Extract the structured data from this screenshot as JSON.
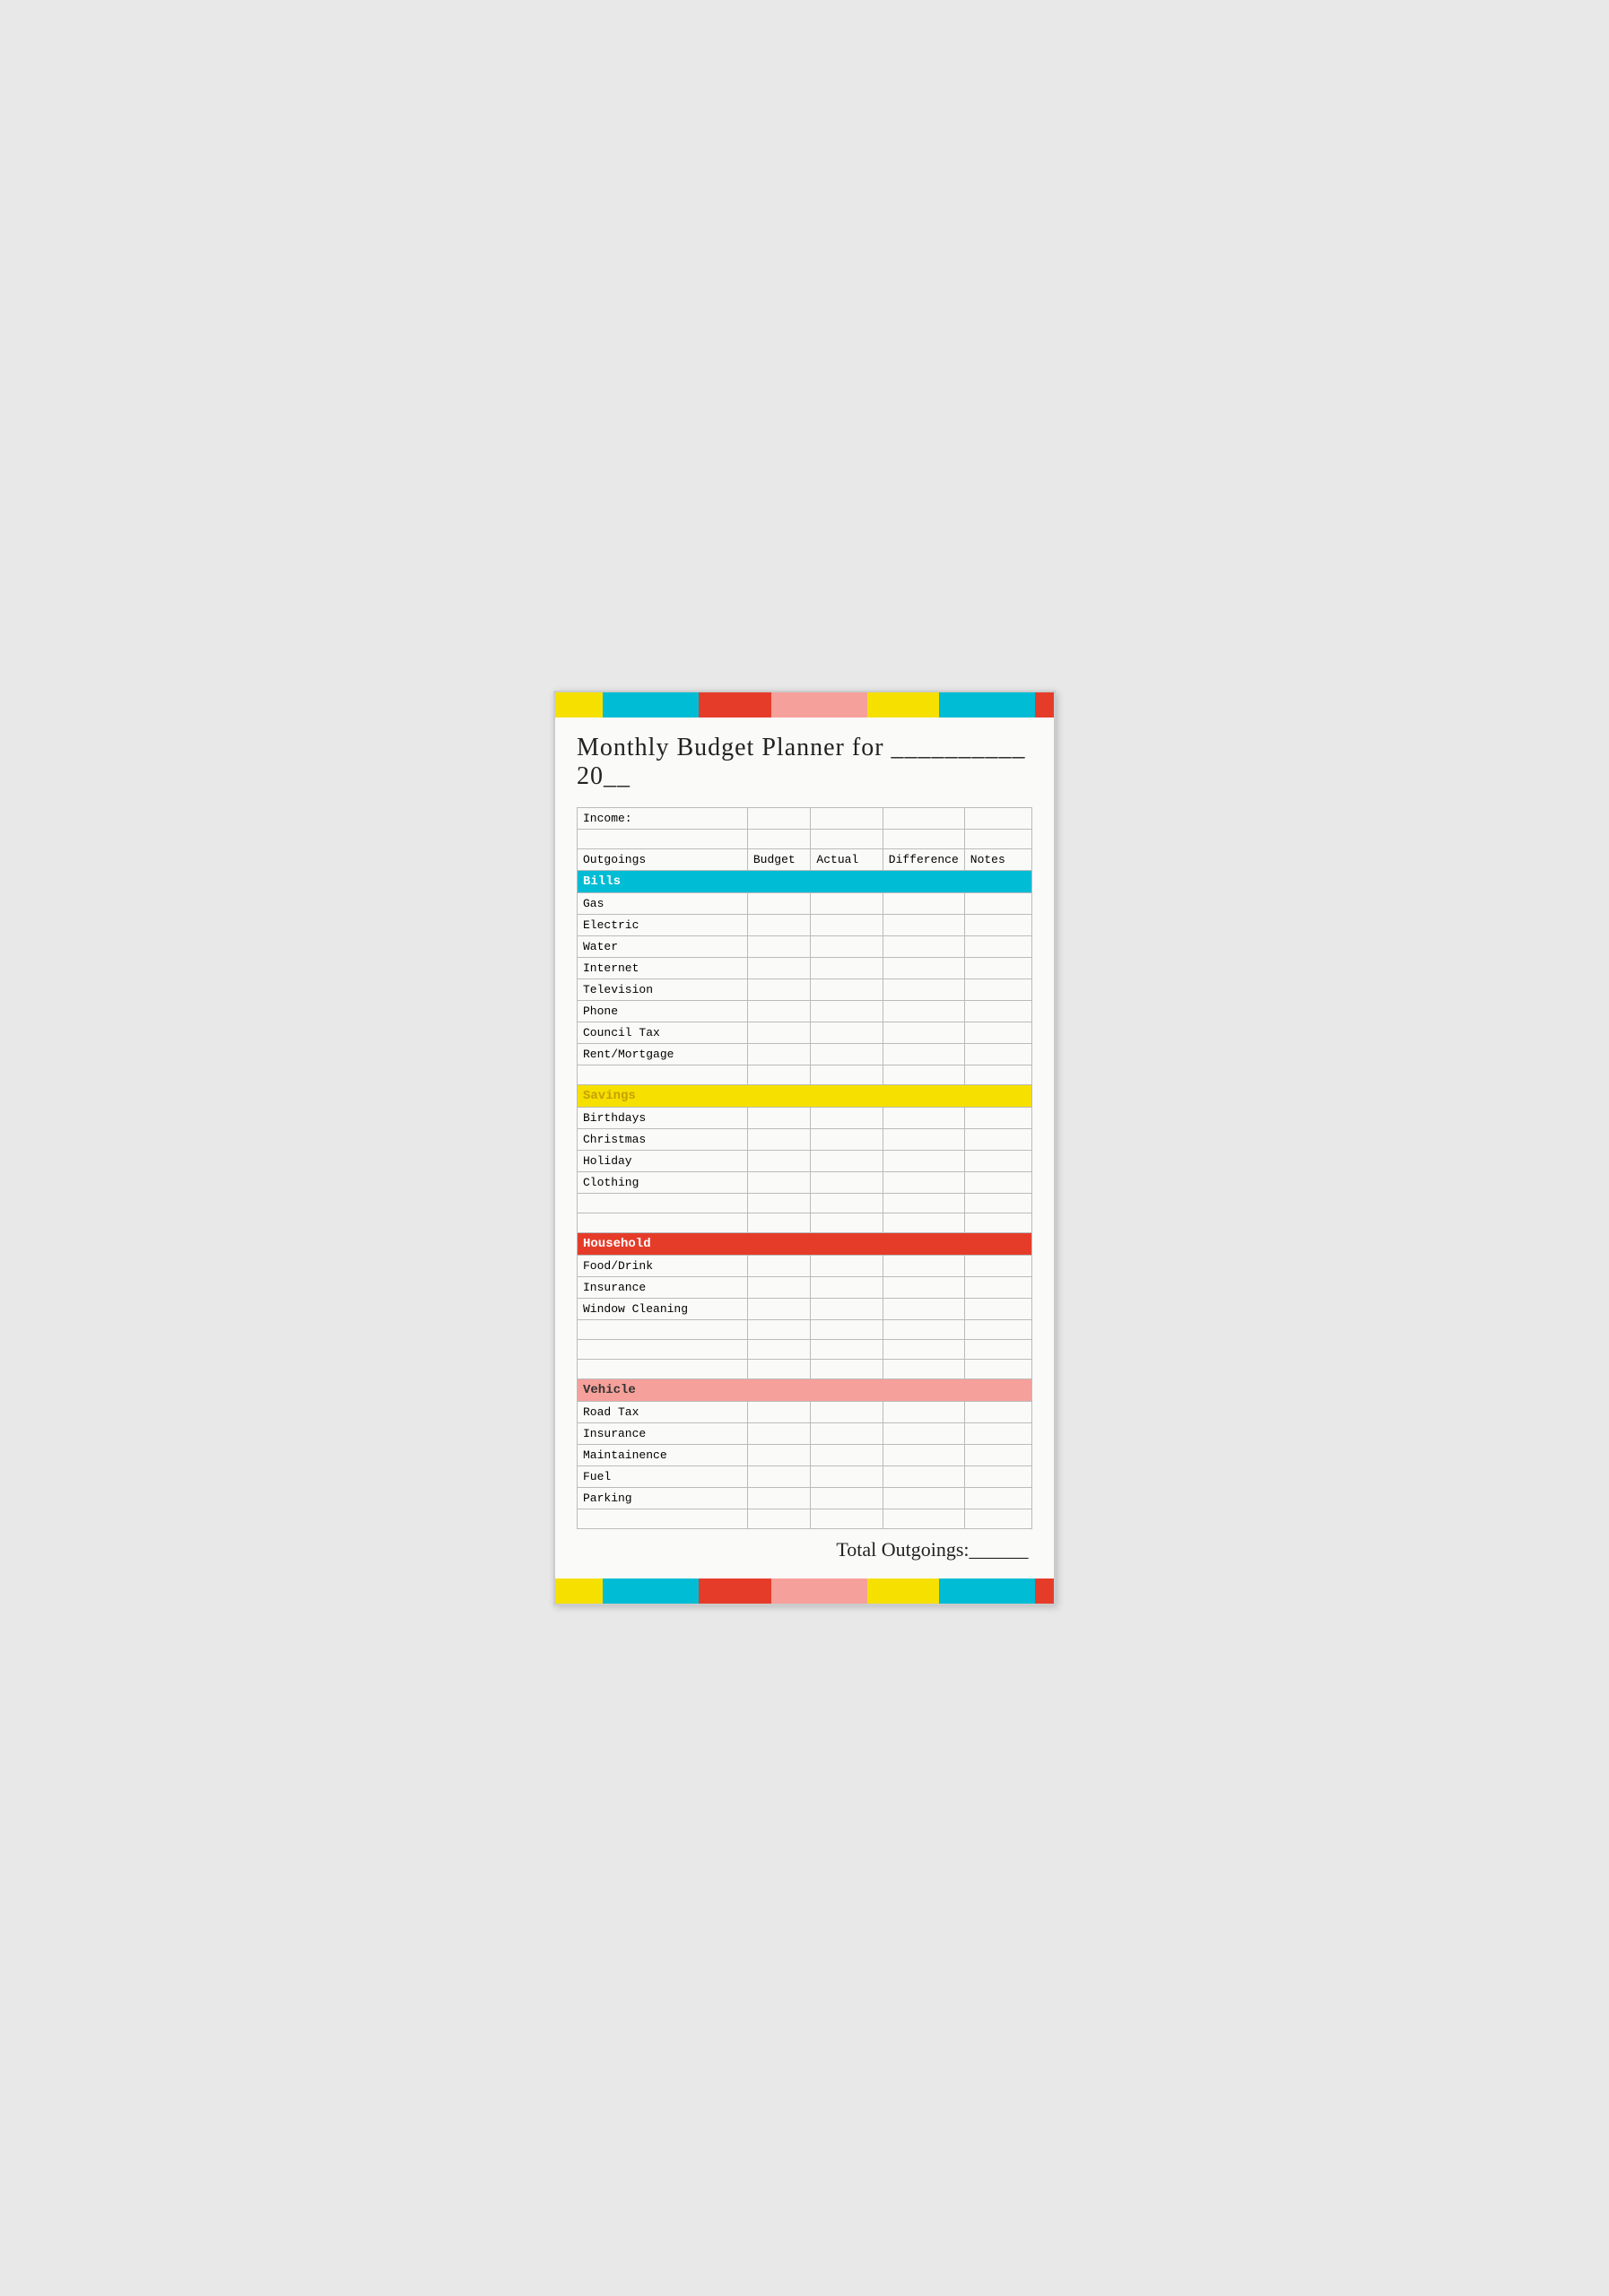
{
  "title": "Monthly Budget Planner for __________ 20__",
  "colorBarsTop": [
    {
      "color": "#f5e000",
      "flex": 1
    },
    {
      "color": "#00bcd4",
      "flex": 2
    },
    {
      "color": "#e53c2a",
      "flex": 1.5
    },
    {
      "color": "#f5a09a",
      "flex": 2
    },
    {
      "color": "#f5e000",
      "flex": 1.5
    },
    {
      "color": "#00bcd4",
      "flex": 2
    },
    {
      "color": "#e53c2a",
      "flex": 0.4
    }
  ],
  "colorBarsBottom": [
    {
      "color": "#f5e000",
      "flex": 1
    },
    {
      "color": "#00bcd4",
      "flex": 2
    },
    {
      "color": "#e53c2a",
      "flex": 1.5
    },
    {
      "color": "#f5a09a",
      "flex": 2
    },
    {
      "color": "#f5e000",
      "flex": 1.5
    },
    {
      "color": "#00bcd4",
      "flex": 2
    },
    {
      "color": "#e53c2a",
      "flex": 0.4
    }
  ],
  "table": {
    "income_label": "Income:",
    "columns": [
      "Outgoings",
      "Budget",
      "Actual",
      "Difference",
      "Notes"
    ],
    "categories": [
      {
        "name": "Bills",
        "color": "bills",
        "items": [
          "Gas",
          "Electric",
          "Water",
          "Internet",
          "Television",
          "Phone",
          "Council Tax",
          "Rent/Mortgage"
        ]
      },
      {
        "name": "Savings",
        "color": "savings",
        "items": [
          "Birthdays",
          "Christmas",
          "Holiday",
          "Clothing"
        ]
      },
      {
        "name": "Household",
        "color": "household",
        "items": [
          "Food/Drink",
          "Insurance",
          "Window Cleaning"
        ]
      },
      {
        "name": "Vehicle",
        "color": "vehicle",
        "items": [
          "Road Tax",
          "Insurance",
          "Maintainence",
          "Fuel",
          "Parking"
        ]
      }
    ],
    "total_label": "Total Outgoings:______"
  }
}
